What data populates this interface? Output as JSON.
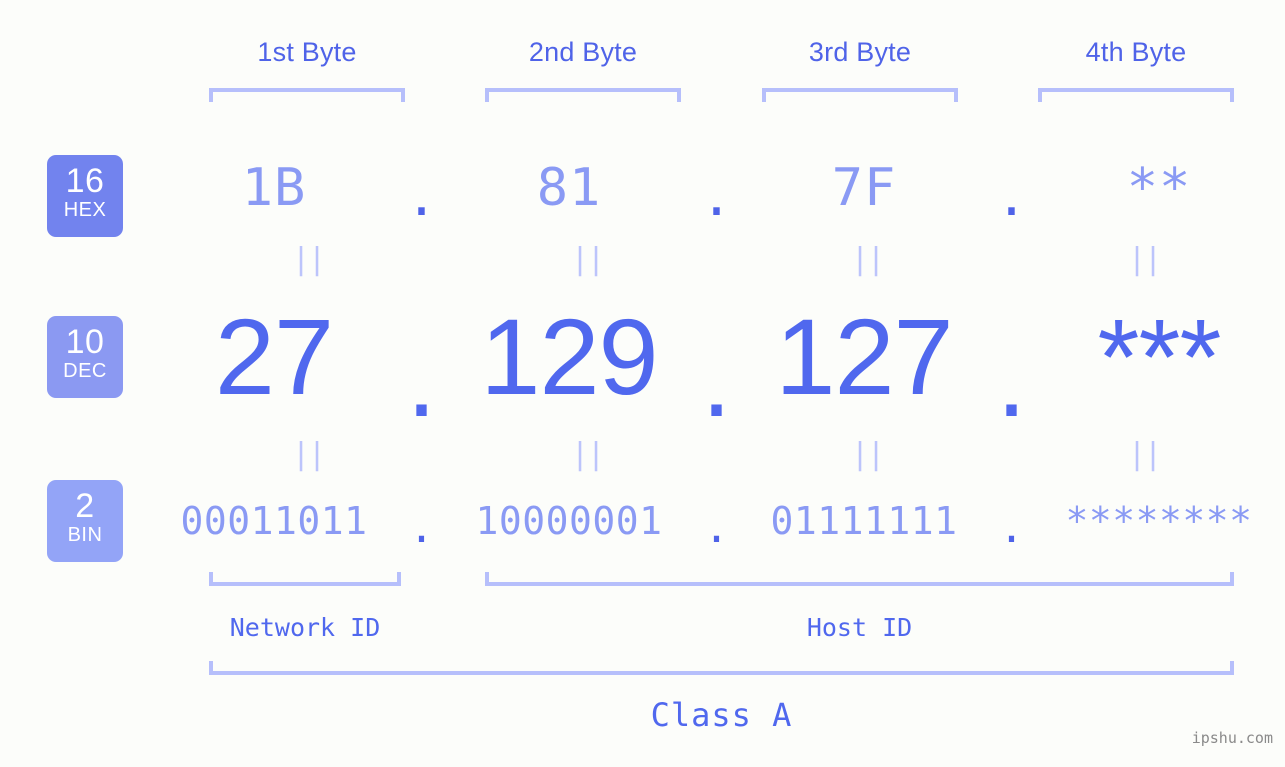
{
  "page": {
    "background_color": "#fcfdfa",
    "accent_strong": "#4f63e8",
    "accent_light": "#8a9af4",
    "bracket_color": "#b6bffb"
  },
  "byte_headers": [
    {
      "label": "1st Byte"
    },
    {
      "label": "2nd Byte"
    },
    {
      "label": "3rd Byte"
    },
    {
      "label": "4th Byte"
    }
  ],
  "bases": [
    {
      "number": "16",
      "abbr": "HEX",
      "color": "#7283ee"
    },
    {
      "number": "10",
      "abbr": "DEC",
      "color": "#8b99f2"
    },
    {
      "number": "2",
      "abbr": "BIN",
      "color": "#93a4f7"
    }
  ],
  "rows": {
    "hex": {
      "values": [
        "1B",
        "81",
        "7F",
        "**"
      ],
      "separators": [
        ".",
        ".",
        "."
      ]
    },
    "dec": {
      "values": [
        "27",
        "129",
        "127",
        "***"
      ],
      "separators": [
        ".",
        ".",
        "."
      ]
    },
    "bin": {
      "values": [
        "00011011",
        "10000001",
        "01111111",
        "********"
      ],
      "separators": [
        ".",
        ".",
        "."
      ]
    }
  },
  "equals_marks": {
    "glyph": "||",
    "count_per_gap": 4
  },
  "sections": {
    "network_id": "Network ID",
    "host_id": "Host ID",
    "class": "Class A"
  },
  "watermark": "ipshu.com"
}
